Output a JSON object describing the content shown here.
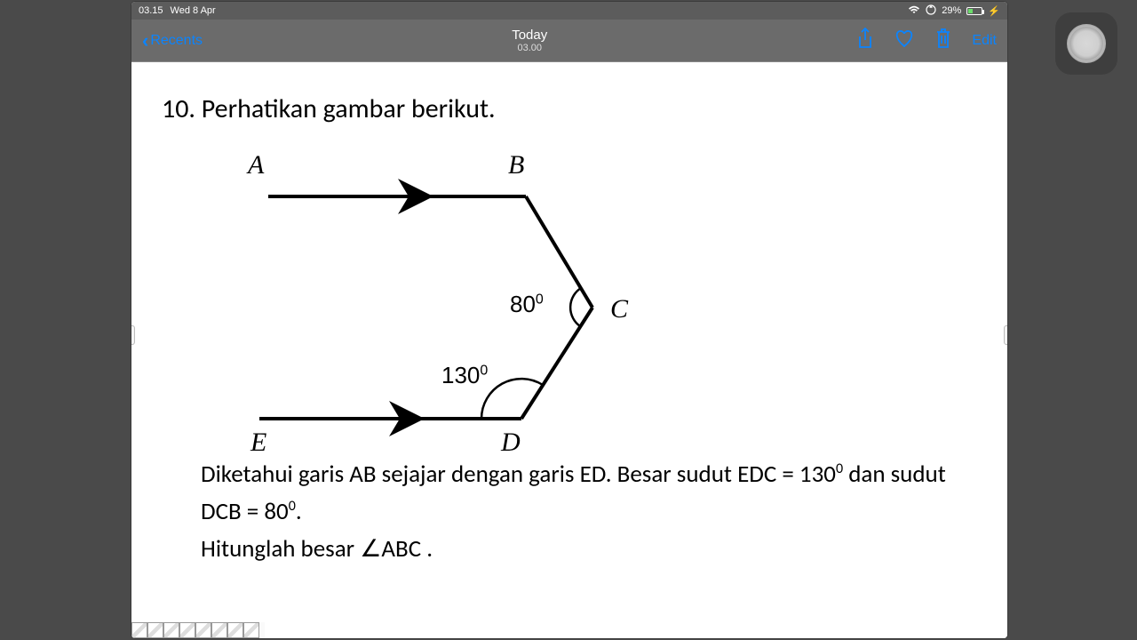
{
  "status": {
    "time": "03.15",
    "date": "Wed 8 Apr",
    "battery": "29%"
  },
  "nav": {
    "back": "Recents",
    "title": "Today",
    "subtitle": "03.00",
    "edit": "Edit"
  },
  "question": {
    "number": "10.",
    "prompt": "Perhatikan gambar berikut.",
    "labels": {
      "A": "A",
      "B": "B",
      "C": "C",
      "D": "D",
      "E": "E"
    },
    "angles": {
      "dcb": "80",
      "edc": "130",
      "deg": "0"
    },
    "text1": "Diketahui garis AB sejajar dengan garis ED. Besar sudut EDC = 130",
    "text1b": "  dan sudut DCB = 80",
    "text1c": ".",
    "text2": "Hitunglah besar  ∠ABC ."
  }
}
